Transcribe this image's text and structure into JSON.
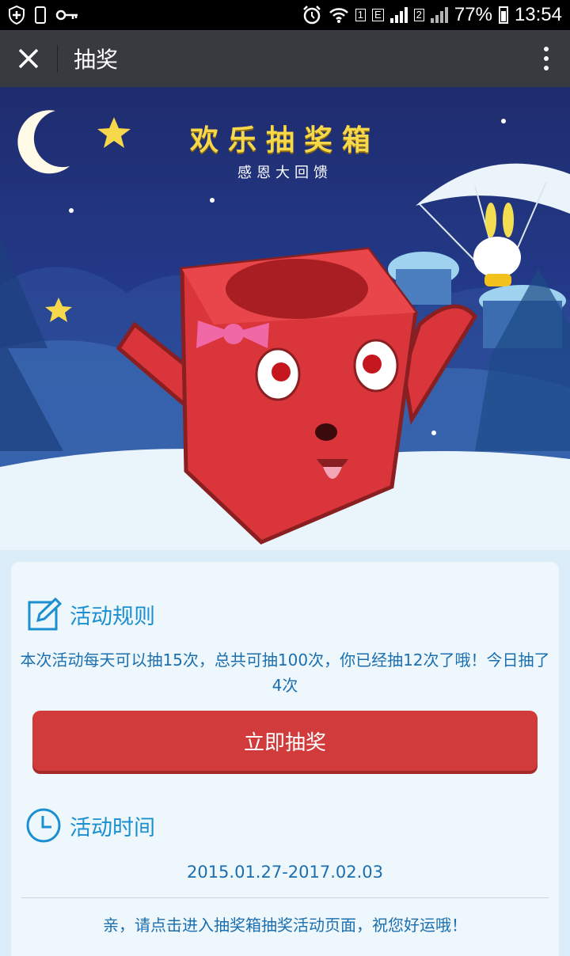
{
  "status_bar": {
    "battery": "77%",
    "time": "13:54",
    "sim1": "1",
    "sim1_type": "E",
    "sim2": "2",
    "icons": [
      "shield-plus-icon",
      "phone-outline-icon",
      "key-icon",
      "alarm-icon",
      "wifi-icon",
      "signal-icon",
      "battery-icon"
    ]
  },
  "title_bar": {
    "title": "抽奖"
  },
  "banner": {
    "title": "欢乐抽奖箱",
    "subtitle": "感恩大回馈"
  },
  "rules": {
    "heading": "活动规则",
    "text": "本次活动每天可以抽15次，总共可抽100次，你已经抽12次了哦！今日抽了4次"
  },
  "draw_button": {
    "label": "立即抽奖"
  },
  "time": {
    "heading": "活动时间",
    "range": "2015.01.27-2017.02.03"
  },
  "footer": {
    "text": "亲，请点击进入抽奖箱抽奖活动页面，祝您好运哦！"
  },
  "colors": {
    "accent_blue": "#1b8fd0",
    "button_red": "#d23b3b",
    "title_bar": "#393a3f"
  }
}
